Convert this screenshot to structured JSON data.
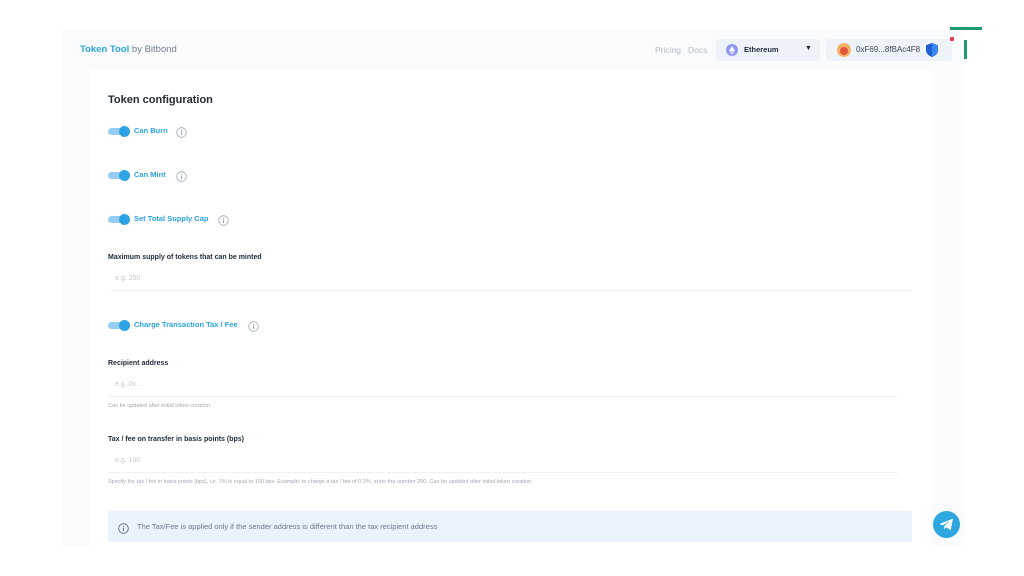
{
  "header": {
    "brand_name": "Token Tool",
    "brand_suffix": " by Bitbond",
    "nav": {
      "pricing": "Pricing",
      "docs": "Docs"
    },
    "network": {
      "label": "Ethereum",
      "icon": "ethereum-icon"
    },
    "wallet": {
      "address": "0xF69...8fBAc4F8",
      "icon": "shield-icon"
    }
  },
  "form": {
    "title": "Token configuration",
    "toggles": {
      "can_burn": {
        "label": "Can Burn",
        "enabled": true
      },
      "can_mint": {
        "label": "Can Mint",
        "enabled": true
      },
      "supply_cap": {
        "label": "Set Total Supply Cap",
        "enabled": true
      },
      "tax": {
        "label": "Charge Transaction Tax / Fee",
        "enabled": true
      }
    },
    "max_supply": {
      "label": "Maximum supply of tokens that can be minted",
      "placeholder": "e.g. 200",
      "value": ""
    },
    "recipient": {
      "label": "Recipient address",
      "placeholder": "e.g. 0x...",
      "value": "",
      "helper": "Can be updated after initial token creation."
    },
    "tax_bps": {
      "label": "Tax / fee on transfer in basis points (bps)",
      "placeholder": "e.g. 100",
      "value": "",
      "helper": "Specify the tax / fee in basis points (bps), i.e. 1% is equal to 100 bps. Example: to charge a tax / fee of 0.2%, enter the number 200. Can be updated after initial token creation."
    },
    "notice": "The Tax/Fee is applied only if the sender address is different than the tax recipient address"
  },
  "colors": {
    "accent": "#2aa4de",
    "toggle_on": "#2ea2e5",
    "notice_bg": "#eaf2fc",
    "corner_mark": "#1f9a72",
    "telegram": "#2ea6e0"
  }
}
